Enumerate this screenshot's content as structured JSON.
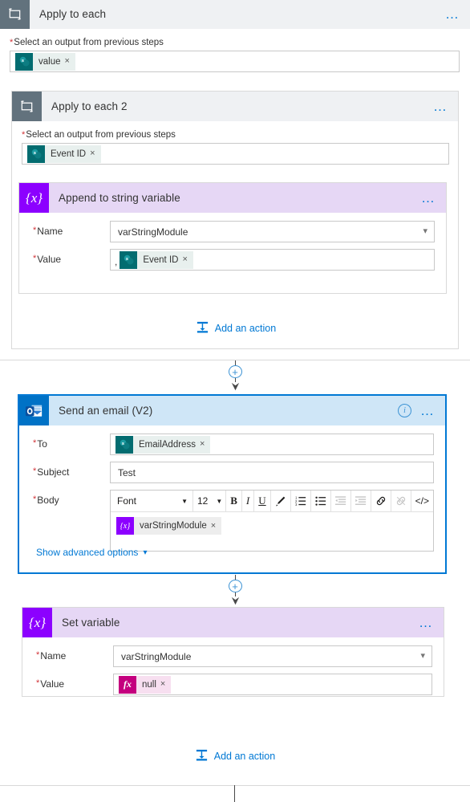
{
  "flow": {
    "outer_loop": {
      "title": "Apply to each",
      "icon": "loop-icon",
      "menu": "…",
      "input_label": "Select an output from previous steps",
      "required": true,
      "token": {
        "text": "value",
        "icon": "sharepoint-icon",
        "remove": "×"
      }
    },
    "inner_loop": {
      "title": "Apply to each 2",
      "icon": "loop-icon",
      "menu": "…",
      "input_label": "Select an output from previous steps",
      "required": true,
      "token": {
        "text": "Event ID",
        "icon": "sharepoint-icon",
        "remove": "×"
      },
      "add_action": {
        "label": "Add an action",
        "icon": "add-action-icon"
      }
    },
    "append_action": {
      "title": "Append to string variable",
      "icon": "variable-icon",
      "icon_glyph": "{x}",
      "menu": "…",
      "fields": {
        "name_label": "Name",
        "name_value": "varStringModule",
        "value_label": "Value",
        "value_prefix": ",",
        "value_token": {
          "text": "Event ID",
          "icon": "sharepoint-icon",
          "remove": "×"
        }
      }
    },
    "email_action": {
      "title": "Send an email (V2)",
      "icon": "outlook-icon",
      "info": "i",
      "menu": "…",
      "fields": {
        "to_label": "To",
        "to_token": {
          "text": "EmailAddress",
          "icon": "sharepoint-icon",
          "remove": "×"
        },
        "subject_label": "Subject",
        "subject_value": "Test",
        "body_label": "Body",
        "body_token": {
          "text": "varStringModule",
          "icon": "variable-icon",
          "remove": "×"
        }
      },
      "toolbar": {
        "font_name": "Font",
        "font_size": "12",
        "caret": "▼",
        "bold": "B",
        "italic": "I",
        "underline": "U",
        "highlight_icon": "pen-icon",
        "numbered_list_icon": "numbered-list-icon",
        "bullet_list_icon": "bullet-list-icon",
        "outdent_icon": "outdent-icon",
        "indent_icon": "indent-icon",
        "link_icon": "link-icon",
        "unlink_icon": "unlink-icon",
        "code_label": "</>"
      },
      "advanced_options": {
        "label": "Show advanced options",
        "icon": "chevron-down-icon"
      }
    },
    "set_variable_action": {
      "title": "Set variable",
      "icon": "variable-icon",
      "icon_glyph": "{x}",
      "menu": "…",
      "fields": {
        "name_label": "Name",
        "name_value": "varStringModule",
        "value_label": "Value",
        "value_token": {
          "text": "null",
          "icon": "expression-icon",
          "icon_glyph": "fx",
          "remove": "×"
        }
      }
    },
    "bottom_add_action": {
      "label": "Add an action",
      "icon": "add-action-icon"
    },
    "connector": {
      "plus": "+",
      "arrow": "arrow-down-icon"
    }
  },
  "colors": {
    "loop_header": "#eff1f3",
    "loop_icon": "#62727d",
    "variable_header": "#e6d7f5",
    "variable_icon": "#8c00ff",
    "email_header": "#cfe6f7",
    "email_icon": "#0072c6",
    "accent_blue": "#0078d4",
    "required_red": "#d13438",
    "sharepoint_teal": "#036c70",
    "expression_magenta": "#c4007e"
  }
}
